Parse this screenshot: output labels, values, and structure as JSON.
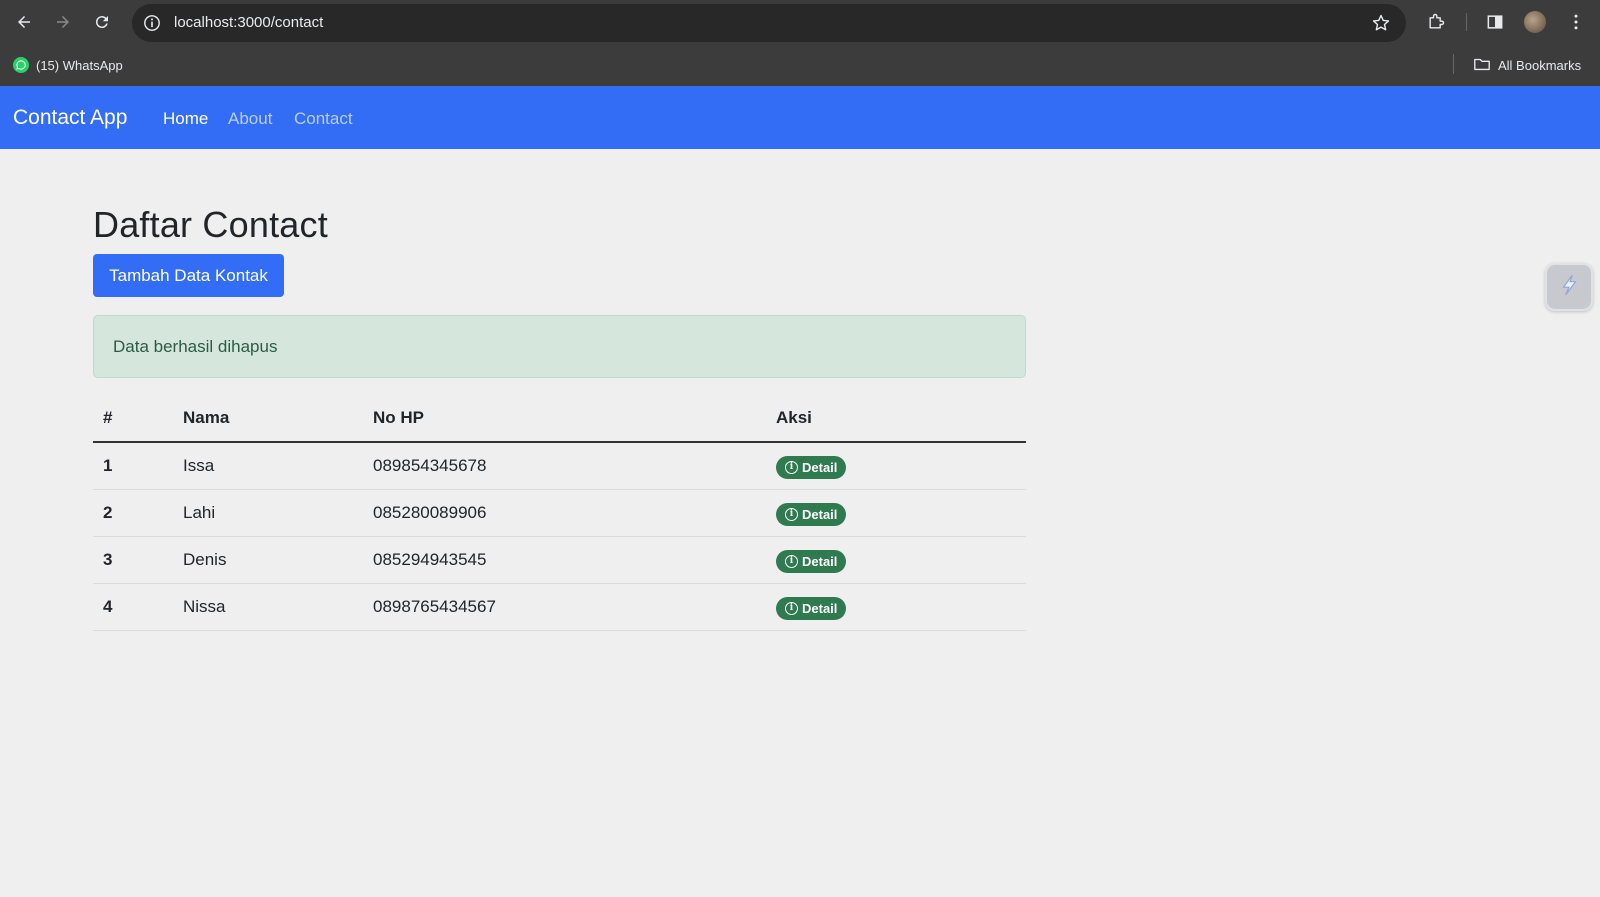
{
  "browser": {
    "url": "localhost:3000/contact",
    "bookmarks": [
      {
        "label": "(15) WhatsApp",
        "icon": "whatsapp-icon"
      }
    ],
    "all_bookmarks_label": "All Bookmarks"
  },
  "navbar": {
    "brand": "Contact App",
    "links": [
      {
        "label": "Home",
        "active": true
      },
      {
        "label": "About",
        "active": false
      },
      {
        "label": "Contact",
        "active": false
      }
    ],
    "color": "#336df5"
  },
  "main": {
    "title": "Daftar Contact",
    "add_button_label": "Tambah Data Kontak",
    "alert_message": "Data berhasil dihapus",
    "table": {
      "headers": [
        "#",
        "Nama",
        "No HP",
        "Aksi"
      ],
      "rows": [
        {
          "num": "1",
          "nama": "Issa",
          "hp": "089854345678",
          "aksi": "Detail"
        },
        {
          "num": "2",
          "nama": "Lahi",
          "hp": "085280089906",
          "aksi": "Detail"
        },
        {
          "num": "3",
          "nama": "Denis",
          "hp": "085294943545",
          "aksi": "Detail"
        },
        {
          "num": "4",
          "nama": "Nissa",
          "hp": "0898765434567",
          "aksi": "Detail"
        }
      ]
    }
  },
  "colors": {
    "primary": "#336df5",
    "success_badge": "#2f7a4f",
    "alert_bg": "#d5e7dd",
    "page_bg": "#efefef"
  }
}
